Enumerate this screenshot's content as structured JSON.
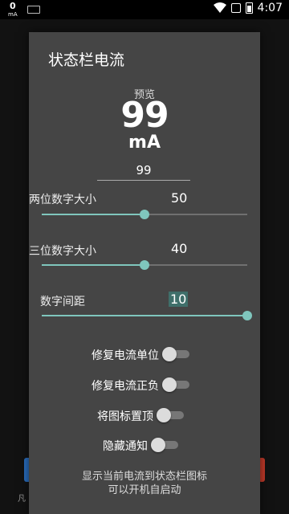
{
  "status_bar": {
    "current_value": "0",
    "current_unit": "mA",
    "time": "4:07",
    "icons": [
      "keyboard-icon",
      "wifi-icon",
      "notification-icon",
      "battery-icon"
    ]
  },
  "background": {
    "partial_label": "凡"
  },
  "dialog": {
    "title": "状态栏电流",
    "preview_label": "预览",
    "preview_number": "99",
    "preview_unit": "mA",
    "preview_input_value": "99",
    "sliders": [
      {
        "label": "两位数字大小",
        "value": "50",
        "fraction": 0.5
      },
      {
        "label": "三位数字大小",
        "value": "40",
        "fraction": 0.5
      },
      {
        "label": "数字间距",
        "value": "10",
        "fraction": 1.0
      }
    ],
    "toggles": [
      {
        "label": "修复电流单位",
        "on": false
      },
      {
        "label": "修复电流正负",
        "on": false
      },
      {
        "label": "将图标置顶",
        "on": false
      },
      {
        "label": "隐藏通知",
        "on": false
      }
    ],
    "footer_line1": "显示当前电流到状态栏图标",
    "footer_line2": "可以开机自启动"
  },
  "colors": {
    "accent": "#7fc6bd",
    "dialog_bg": "#454545",
    "selection_bg": "#3f6f6a"
  }
}
